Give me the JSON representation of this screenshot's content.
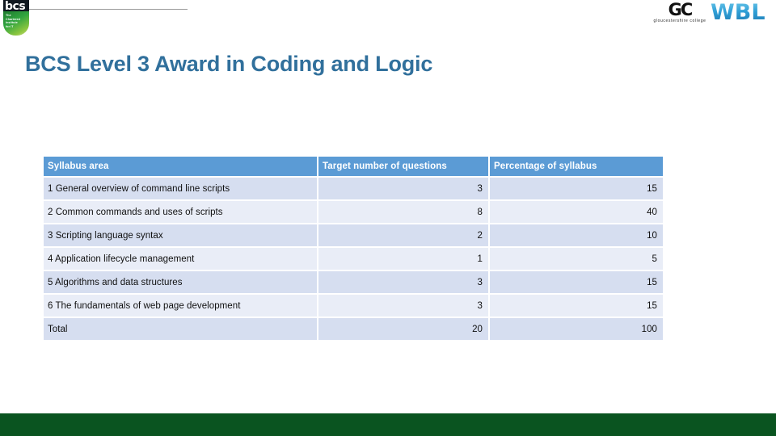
{
  "header": {
    "bcs_logo": {
      "icon": "bcs-shield-logo",
      "wordmark": "bcs",
      "strapline_lines": [
        "The",
        "Chartered",
        "Institute",
        "for IT"
      ]
    },
    "gc_logo": {
      "icon": "gloucestershire-college-logo",
      "mark": "GC",
      "name": "gloucestershire college"
    },
    "wbl_logo": {
      "icon": "wbl-logo",
      "text": "WBL"
    },
    "rule": "header-divider-rule"
  },
  "title": "BCS Level 3 Award in Coding and Logic",
  "table": {
    "name": "syllabus-weighting-table",
    "columns": [
      "Syllabus area",
      "Target number of questions",
      "Percentage of syllabus"
    ],
    "rows": [
      {
        "area": "1 General overview of command line scripts",
        "target": "3",
        "percentage": "15"
      },
      {
        "area": "2 Common commands and uses of scripts",
        "target": "8",
        "percentage": "40"
      },
      {
        "area": "3 Scripting language syntax",
        "target": "2",
        "percentage": "10"
      },
      {
        "area": "4 Application lifecycle management",
        "target": "1",
        "percentage": "5"
      },
      {
        "area": "5 Algorithms and data structures",
        "target": "3",
        "percentage": "15"
      },
      {
        "area": "6 The fundamentals of web page development",
        "target": "3",
        "percentage": "15"
      },
      {
        "area": "Total",
        "target": "20",
        "percentage": "100"
      }
    ]
  },
  "footer": {
    "bar_color": "#0a5420"
  },
  "colors": {
    "title_blue": "#31709c",
    "header_blue": "#5b9bd5",
    "row_band_a": "#d6def0",
    "row_band_b": "#e9edf7",
    "footer_green": "#0a5420"
  }
}
